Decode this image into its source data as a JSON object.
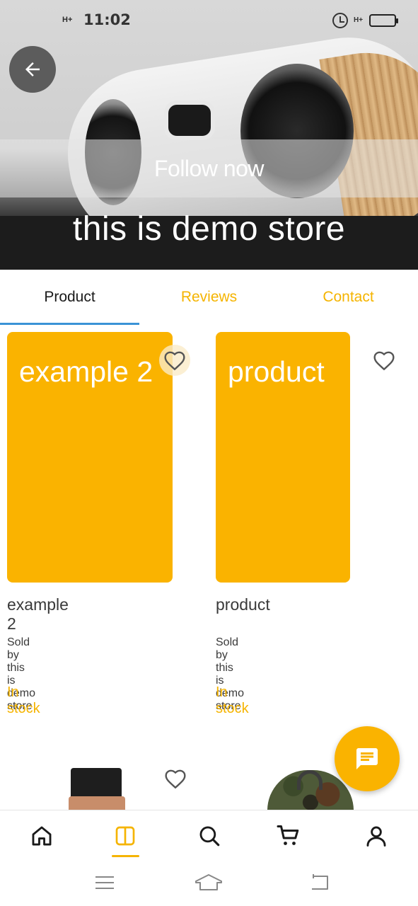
{
  "status_bar": {
    "network": "H+",
    "time": "11:02",
    "secondary_network": "H+"
  },
  "header": {
    "follow_label": "Follow now",
    "store_name": "this is demo store"
  },
  "tabs": [
    {
      "label": "Product",
      "active": true
    },
    {
      "label": "Reviews",
      "active": false
    },
    {
      "label": "Contact",
      "active": false
    }
  ],
  "products": [
    {
      "image_text": "example 2",
      "name": "example 2",
      "sold_by": "Sold by this is demo store",
      "stock": "In stock"
    },
    {
      "image_text": "product",
      "name": "product",
      "sold_by": "Sold by this is demo store",
      "stock": "In stock"
    }
  ],
  "bottom_nav": [
    {
      "icon": "home-icon",
      "active": false
    },
    {
      "icon": "store-icon",
      "active": true
    },
    {
      "icon": "search-icon",
      "active": false
    },
    {
      "icon": "cart-icon",
      "active": false
    },
    {
      "icon": "profile-icon",
      "active": false
    }
  ],
  "colors": {
    "accent": "#fab300",
    "tab_indicator": "#3a93d6",
    "text_dark": "#3a3a3a"
  }
}
